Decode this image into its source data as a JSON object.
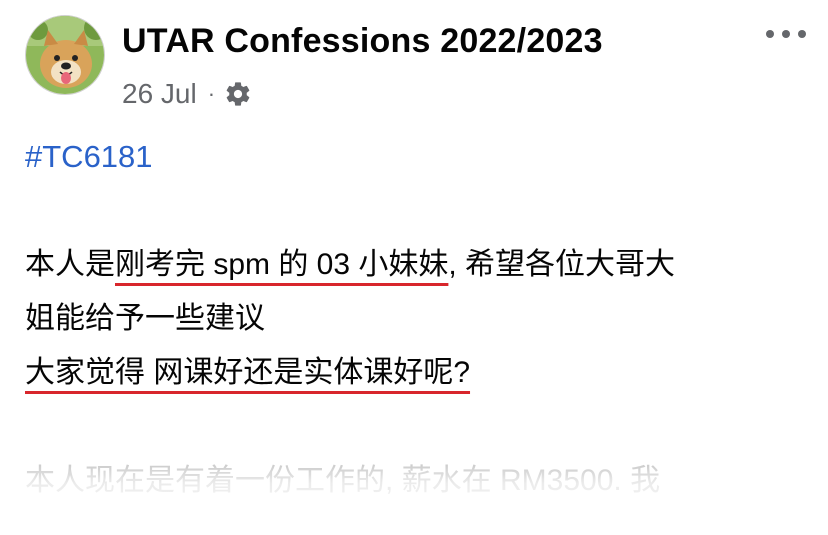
{
  "post": {
    "author": "UTAR Confessions 2022/2023",
    "date": "26 Jul",
    "separator": "·",
    "audience_icon": "gear-icon",
    "more_icon": "more-dots-icon",
    "hashtag": "#TC6181",
    "body_lines": [
      {
        "segments": [
          {
            "text": "本人是",
            "underline": false
          },
          {
            "text": "刚考完 spm 的 03 小妹妹",
            "underline": true
          },
          {
            "text": ", 希望各位大哥大",
            "underline": false
          }
        ]
      },
      {
        "segments": [
          {
            "text": "姐能给予一些建议",
            "underline": false
          }
        ]
      },
      {
        "segments": [
          {
            "text": "大家觉得 网课好还是实体课好呢?",
            "underline": true
          }
        ]
      }
    ],
    "faded_line": "本人现在是有着一份工作的, 薪水在 RM3500. 我"
  },
  "colors": {
    "hashtag": "#2a62c9",
    "underline": "#d8262c",
    "meta": "#65676b",
    "text": "#050505"
  }
}
